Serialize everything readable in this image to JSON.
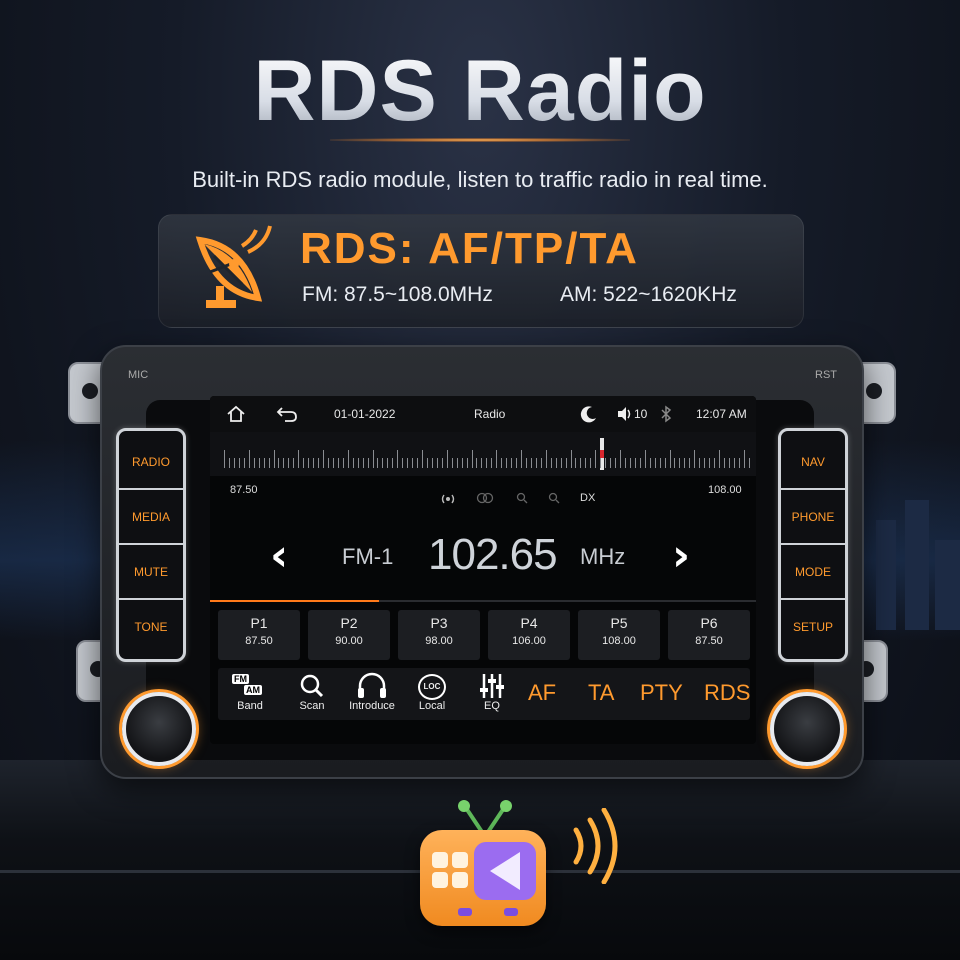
{
  "header": {
    "title": "RDS Radio",
    "subtitle": "Built-in RDS radio module, listen to traffic radio in real time."
  },
  "banner": {
    "rds": "RDS:  AF/TP/TA",
    "fm": "FM: 87.5~108.0MHz",
    "am": "AM: 522~1620KHz"
  },
  "unit": {
    "mic_label": "MIC",
    "rst_label": "RST",
    "left_buttons": [
      "RADIO",
      "MEDIA",
      "MUTE",
      "TONE"
    ],
    "right_buttons": [
      "NAV",
      "PHONE",
      "MODE",
      "SETUP"
    ]
  },
  "status": {
    "date": "01-01-2022",
    "app": "Radio",
    "volume": "10",
    "time": "12:07 AM"
  },
  "tuner": {
    "min": "87.50",
    "max": "108.00",
    "dx": "DX",
    "band": "FM-1",
    "frequency": "102.65",
    "unit": "MHz",
    "progress": 0.31
  },
  "presets": [
    {
      "name": "P1",
      "freq": "87.50"
    },
    {
      "name": "P2",
      "freq": "90.00"
    },
    {
      "name": "P3",
      "freq": "98.00"
    },
    {
      "name": "P4",
      "freq": "106.00"
    },
    {
      "name": "P5",
      "freq": "108.00"
    },
    {
      "name": "P6",
      "freq": "87.50"
    }
  ],
  "toolbar": {
    "band_fm": "FM",
    "band_am": "AM",
    "band": "Band",
    "scan": "Scan",
    "introduce": "Introduce",
    "loc": "LOC",
    "local": "Local",
    "eq": "EQ",
    "af": "AF",
    "ta": "TA",
    "pty": "PTY",
    "rds": "RDS"
  },
  "colors": {
    "accent": "#ff9a2e",
    "background": "#151b28"
  }
}
